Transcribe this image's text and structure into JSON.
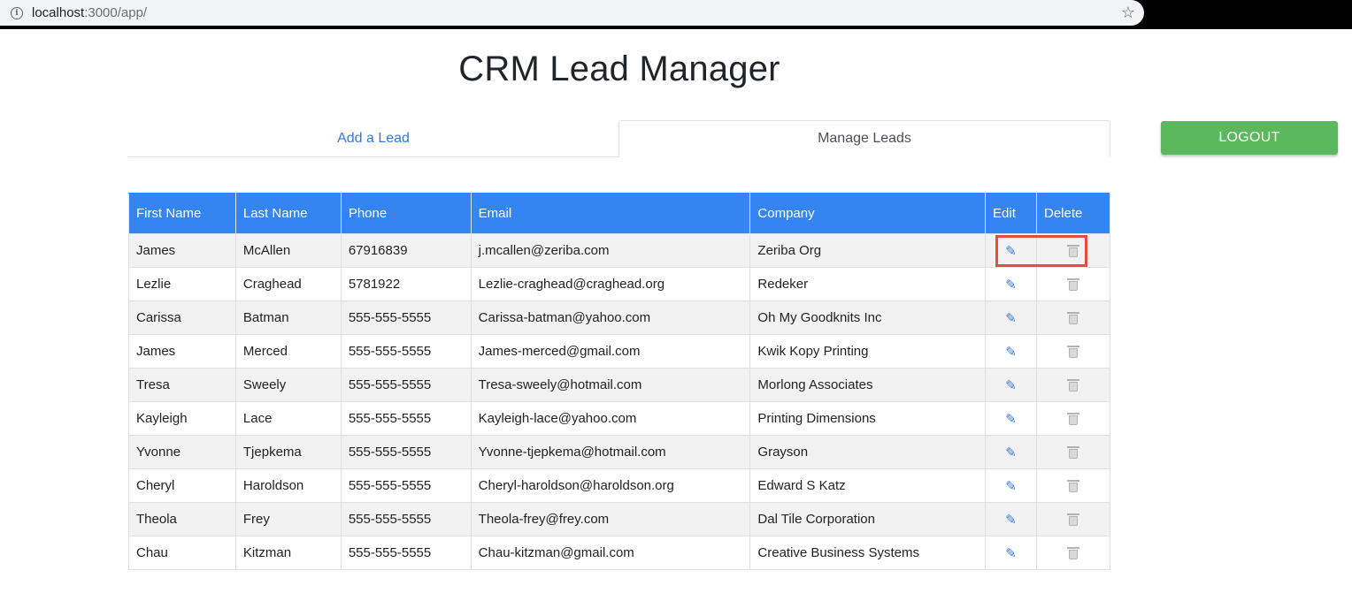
{
  "browser": {
    "url_host": "localhost",
    "url_rest": ":3000/app/"
  },
  "page": {
    "title": "CRM Lead Manager"
  },
  "tabs": [
    {
      "label": "Add a Lead",
      "active": false
    },
    {
      "label": "Manage Leads",
      "active": true
    }
  ],
  "logout_label": "LOGOUT",
  "colors": {
    "header_blue": "#3485f2",
    "logout_green": "#5cb85c",
    "link_blue": "#2f7bdf",
    "highlight_red": "#e24d40"
  },
  "table": {
    "columns": [
      "First Name",
      "Last Name",
      "Phone",
      "Email",
      "Company",
      "Edit",
      "Delete"
    ],
    "rows": [
      [
        "James",
        "McAllen",
        "67916839",
        "j.mcallen@zeriba.com",
        "Zeriba Org"
      ],
      [
        "Lezlie",
        "Craghead",
        "5781922",
        "Lezlie-craghead@craghead.org",
        "Redeker"
      ],
      [
        "Carissa",
        "Batman",
        "555-555-5555",
        "Carissa-batman@yahoo.com",
        "Oh My Goodknits Inc"
      ],
      [
        "James",
        "Merced",
        "555-555-5555",
        "James-merced@gmail.com",
        "Kwik Kopy Printing"
      ],
      [
        "Tresa",
        "Sweely",
        "555-555-5555",
        "Tresa-sweely@hotmail.com",
        "Morlong Associates"
      ],
      [
        "Kayleigh",
        "Lace",
        "555-555-5555",
        "Kayleigh-lace@yahoo.com",
        "Printing Dimensions"
      ],
      [
        "Yvonne",
        "Tjepkema",
        "555-555-5555",
        "Yvonne-tjepkema@hotmail.com",
        "Grayson"
      ],
      [
        "Cheryl",
        "Haroldson",
        "555-555-5555",
        "Cheryl-haroldson@haroldson.org",
        "Edward S Katz"
      ],
      [
        "Theola",
        "Frey",
        "555-555-5555",
        "Theola-frey@frey.com",
        "Dal Tile Corporation"
      ],
      [
        "Chau",
        "Kitzman",
        "555-555-5555",
        "Chau-kitzman@gmail.com",
        "Creative Business Systems"
      ]
    ]
  }
}
